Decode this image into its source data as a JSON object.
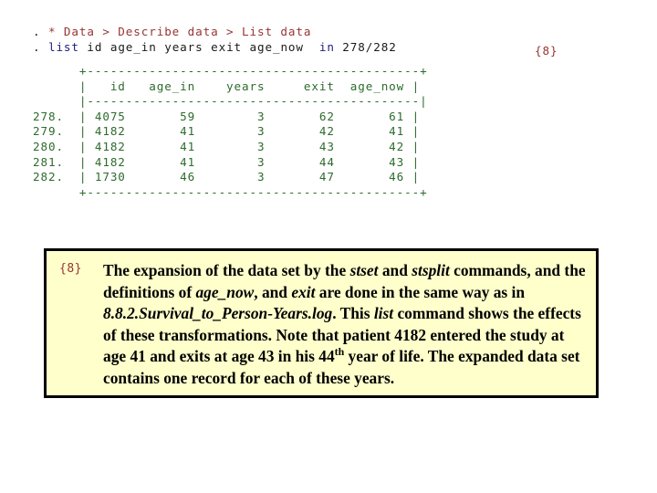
{
  "slide": {
    "background_color": "#ffffff",
    "ref_tag": "{8}"
  },
  "console": {
    "colors": {
      "comment": "#993333",
      "command": "#202080",
      "text": "#1a1a1a",
      "table": "#2d6b2d"
    },
    "lines": [
      {
        "prompt": ".",
        "segments": [
          {
            "text": " * Data > Describe data > List data",
            "style": "comment"
          }
        ],
        "plain": ". * Data > Describe data > List data"
      },
      {
        "prompt": ".",
        "segments": [
          {
            "text": " ",
            "style": "text"
          },
          {
            "text": "list",
            "style": "command"
          },
          {
            "text": " id age_in years exit age_now  ",
            "style": "text"
          },
          {
            "text": "in",
            "style": "command"
          },
          {
            "text": " 278/282",
            "style": "text"
          }
        ],
        "plain": ". list id age_in years exit age_now  in 278/282"
      }
    ]
  },
  "table": {
    "color": "#2d6b2d",
    "columns": [
      "id",
      "age_in",
      "years",
      "exit",
      "age_now"
    ],
    "row_labels": [
      "278.",
      "279.",
      "280.",
      "281.",
      "282."
    ],
    "rows": [
      {
        "obs": "278.",
        "id": "4075",
        "age_in": "59",
        "years": "3",
        "exit": "62",
        "age_now": "61"
      },
      {
        "obs": "279.",
        "id": "4182",
        "age_in": "41",
        "years": "3",
        "exit": "42",
        "age_now": "41"
      },
      {
        "obs": "280.",
        "id": "4182",
        "age_in": "41",
        "years": "3",
        "exit": "43",
        "age_now": "42"
      },
      {
        "obs": "281.",
        "id": "4182",
        "age_in": "41",
        "years": "3",
        "exit": "44",
        "age_now": "43"
      },
      {
        "obs": "282.",
        "id": "1730",
        "age_in": "46",
        "years": "3",
        "exit": "47",
        "age_now": "46"
      }
    ],
    "ascii": {
      "top_rule": "      +----------------------------------+",
      "header": "      |   id   age_in    years    exit   age_now |",
      "mid_rule": "      |----------------------------------|",
      "bottom_rule": "      +----------------------------------+"
    },
    "rendered_lines": [
      "      +----------------------------+",
      "      |   id   age_in    years    exit   age_now |",
      "      |----------------------------|",
      "278.  | 4075       59        3       62        61 |",
      "279.  | 4182       41        3       42        41 |",
      "280.  | 4182       41        3       43        42 |",
      "281.  | 4182       41        3       44        43 |",
      "282.  | 1730       46        3       47        46 |",
      "      +----------------------------+"
    ]
  },
  "callout": {
    "tag": "{8}",
    "background_color": "#ffffcc",
    "border_color": "#000000",
    "tag_color": "#993333",
    "text_plain": "The expansion of the data set by the stset and stsplit commands, and the definitions of age_now, and exit are done in the same way as in 8.8.2.Survival_to_Person-Years.log.  This list command shows the effects of these transformations.  Note that patient 4182 entered the study at age 41 and exits at age 43 in his 44th year of life.  The expanded data set contains one record for each of these years.",
    "runs": [
      {
        "text": "The ",
        "style": "regular"
      },
      {
        "text": "expansion",
        "style": "bold"
      },
      {
        "text": " of the data set by the ",
        "style": "regular"
      },
      {
        "text": "stset",
        "style": "italic"
      },
      {
        "text": " and ",
        "style": "regular"
      },
      {
        "text": "stsplit",
        "style": "italic"
      },
      {
        "text": " commands, and the definitions of ",
        "style": "regular"
      },
      {
        "text": "age_now",
        "style": "italic"
      },
      {
        "text": ", and ",
        "style": "regular"
      },
      {
        "text": "exit",
        "style": "italic"
      },
      {
        "text": " are done in the same way as in ",
        "style": "regular"
      },
      {
        "text": "8.8.2.Survival_to_Person-Years.log",
        "style": "italic"
      },
      {
        "text": ".  This ",
        "style": "regular"
      },
      {
        "text": "list",
        "style": "italic"
      },
      {
        "text": " command shows the effects of these transformations.  Note that patient ",
        "style": "regular"
      },
      {
        "text": "4182",
        "style": "bold"
      },
      {
        "text": " entered the study at age ",
        "style": "regular"
      },
      {
        "text": "41",
        "style": "bold"
      },
      {
        "text": " and exits at age ",
        "style": "regular"
      },
      {
        "text": "43",
        "style": "bold"
      },
      {
        "text": " in his ",
        "style": "regular"
      },
      {
        "text": "44",
        "style": "bold"
      },
      {
        "text": "th",
        "style": "superscript"
      },
      {
        "text": " year of life.  The expanded data set contains one record for each of these years.",
        "style": "regular"
      }
    ]
  }
}
